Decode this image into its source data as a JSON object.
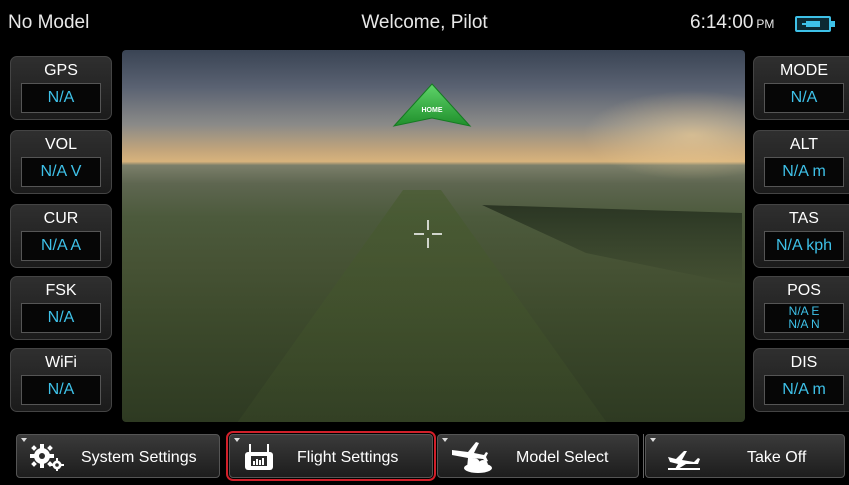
{
  "topbar": {
    "model_name": "No Model",
    "welcome": "Welcome, Pilot",
    "time": "6:14:00",
    "ampm": "PM"
  },
  "left_panel": [
    {
      "label": "GPS",
      "value": "N/A"
    },
    {
      "label": "VOL",
      "value": "N/A V"
    },
    {
      "label": "CUR",
      "value": "N/A A"
    },
    {
      "label": "FSK",
      "value": "N/A"
    },
    {
      "label": "WiFi",
      "value": "N/A"
    }
  ],
  "right_panel": [
    {
      "label": "MODE",
      "value": "N/A"
    },
    {
      "label": "ALT",
      "value": "N/A m"
    },
    {
      "label": "TAS",
      "value": "N/A kph"
    },
    {
      "label": "POS",
      "value_e": "N/A E",
      "value_n": "N/A N"
    },
    {
      "label": "DIS",
      "value": "N/A m"
    }
  ],
  "camera": {
    "home_label": "HOME"
  },
  "bottom_nav": [
    {
      "label": "System Settings",
      "icon": "gears-icon",
      "active": false
    },
    {
      "label": "Flight Settings",
      "icon": "transmitter-icon",
      "active": true
    },
    {
      "label": "Model Select",
      "icon": "plane-cloud-icon",
      "active": false
    },
    {
      "label": "Take Off",
      "icon": "takeoff-icon",
      "active": false
    }
  ],
  "colors": {
    "accent": "#3ec1e8",
    "active_outline": "#d1202a",
    "home_marker": "#2fae3a"
  }
}
